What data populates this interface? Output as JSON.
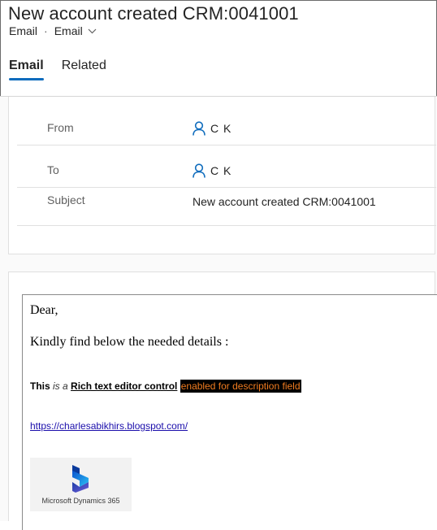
{
  "header": {
    "title": "New account created CRM:0041001",
    "entity": "Email",
    "separator": "·",
    "form_selector": "Email"
  },
  "tabs": [
    {
      "label": "Email",
      "active": true
    },
    {
      "label": "Related",
      "active": false
    }
  ],
  "fields": {
    "from": {
      "label": "From",
      "value": "C K"
    },
    "to": {
      "label": "To",
      "value": "C K"
    },
    "subject": {
      "label": "Subject",
      "value": "New account created CRM:0041001"
    }
  },
  "description": {
    "greeting": "Dear,",
    "intro": "Kindly find below the needed details :",
    "rich": {
      "bold": "This",
      "italic": "is a",
      "underlined": "Rich text editor control",
      "highlighted": "enabled for description field"
    },
    "link": "https://charlesabikhirs.blogspot.com/",
    "logo_text": "Microsoft Dynamics 365"
  },
  "colors": {
    "accent": "#0f6cbd",
    "highlight_bg": "#000000",
    "highlight_fg": "#f07c20",
    "link": "#1a0dab"
  },
  "icons": {
    "lookup": "person-icon",
    "dropdown": "chevron-down-icon",
    "logo": "dynamics-365-logo"
  }
}
